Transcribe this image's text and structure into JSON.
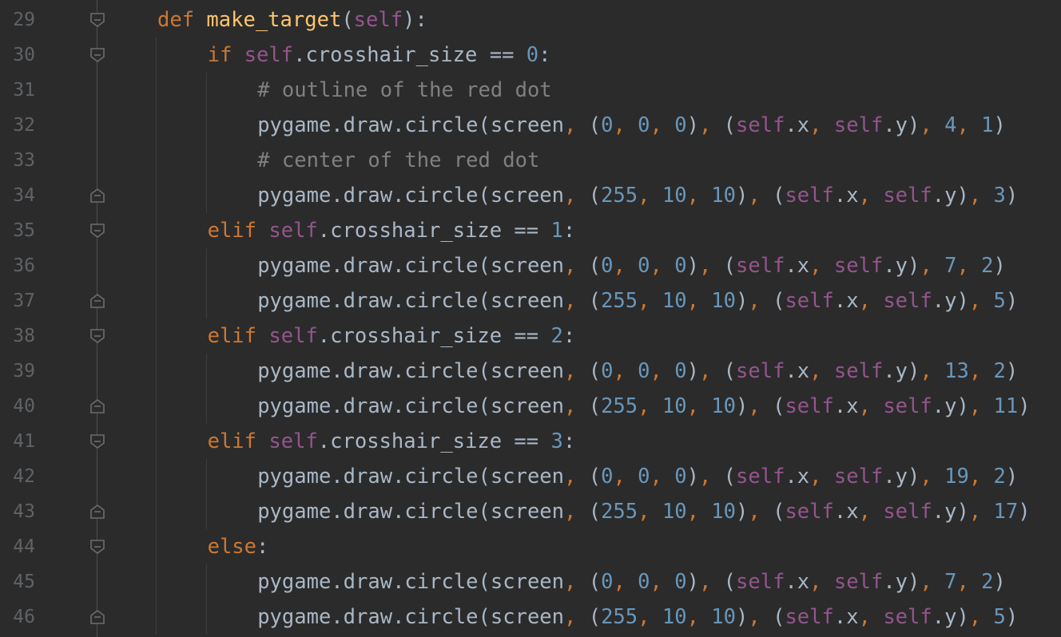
{
  "theme": {
    "background": "#2b2b2b",
    "keyword": "#cc7832",
    "function_name": "#ffc66d",
    "self": "#94558d",
    "number": "#6897bb",
    "comment": "#808080",
    "text": "#a9b7c6",
    "line_number": "#606366"
  },
  "lines": [
    {
      "n": "29",
      "indent": 0,
      "fold": "start",
      "tokens": [
        [
          "kw",
          "def"
        ],
        [
          "tx",
          " "
        ],
        [
          "fn",
          "make_target"
        ],
        [
          "tx",
          "("
        ],
        [
          "slf",
          "self"
        ],
        [
          "tx",
          "):"
        ]
      ]
    },
    {
      "n": "30",
      "indent": 1,
      "fold": "start",
      "tokens": [
        [
          "kw",
          "if"
        ],
        [
          "tx",
          " "
        ],
        [
          "slf",
          "self"
        ],
        [
          "tx",
          ".crosshair_size == "
        ],
        [
          "num",
          "0"
        ],
        [
          "tx",
          ":"
        ]
      ]
    },
    {
      "n": "31",
      "indent": 2,
      "fold": "",
      "tokens": [
        [
          "cm",
          "# outline of the red dot"
        ]
      ]
    },
    {
      "n": "32",
      "indent": 2,
      "fold": "",
      "tokens": [
        [
          "tx",
          "pygame.draw.circle(screen"
        ],
        [
          "pn",
          ", "
        ],
        [
          "tx",
          "("
        ],
        [
          "num",
          "0"
        ],
        [
          "pn",
          ", "
        ],
        [
          "num",
          "0"
        ],
        [
          "pn",
          ", "
        ],
        [
          "num",
          "0"
        ],
        [
          "tx",
          ")"
        ],
        [
          "pn",
          ", "
        ],
        [
          "tx",
          "("
        ],
        [
          "slf",
          "self"
        ],
        [
          "tx",
          ".x"
        ],
        [
          "pn",
          ", "
        ],
        [
          "slf",
          "self"
        ],
        [
          "tx",
          ".y)"
        ],
        [
          "pn",
          ", "
        ],
        [
          "num",
          "4"
        ],
        [
          "pn",
          ", "
        ],
        [
          "num",
          "1"
        ],
        [
          "tx",
          ")"
        ]
      ]
    },
    {
      "n": "33",
      "indent": 2,
      "fold": "",
      "tokens": [
        [
          "cm",
          "# center of the red dot"
        ]
      ]
    },
    {
      "n": "34",
      "indent": 2,
      "fold": "end",
      "tokens": [
        [
          "tx",
          "pygame.draw.circle(screen"
        ],
        [
          "pn",
          ", "
        ],
        [
          "tx",
          "("
        ],
        [
          "num",
          "255"
        ],
        [
          "pn",
          ", "
        ],
        [
          "num",
          "10"
        ],
        [
          "pn",
          ", "
        ],
        [
          "num",
          "10"
        ],
        [
          "tx",
          ")"
        ],
        [
          "pn",
          ", "
        ],
        [
          "tx",
          "("
        ],
        [
          "slf",
          "self"
        ],
        [
          "tx",
          ".x"
        ],
        [
          "pn",
          ", "
        ],
        [
          "slf",
          "self"
        ],
        [
          "tx",
          ".y)"
        ],
        [
          "pn",
          ", "
        ],
        [
          "num",
          "3"
        ],
        [
          "tx",
          ")"
        ]
      ]
    },
    {
      "n": "35",
      "indent": 1,
      "fold": "start",
      "tokens": [
        [
          "kw",
          "elif"
        ],
        [
          "tx",
          " "
        ],
        [
          "slf",
          "self"
        ],
        [
          "tx",
          ".crosshair_size == "
        ],
        [
          "num",
          "1"
        ],
        [
          "tx",
          ":"
        ]
      ]
    },
    {
      "n": "36",
      "indent": 2,
      "fold": "",
      "tokens": [
        [
          "tx",
          "pygame.draw.circle(screen"
        ],
        [
          "pn",
          ", "
        ],
        [
          "tx",
          "("
        ],
        [
          "num",
          "0"
        ],
        [
          "pn",
          ", "
        ],
        [
          "num",
          "0"
        ],
        [
          "pn",
          ", "
        ],
        [
          "num",
          "0"
        ],
        [
          "tx",
          ")"
        ],
        [
          "pn",
          ", "
        ],
        [
          "tx",
          "("
        ],
        [
          "slf",
          "self"
        ],
        [
          "tx",
          ".x"
        ],
        [
          "pn",
          ", "
        ],
        [
          "slf",
          "self"
        ],
        [
          "tx",
          ".y)"
        ],
        [
          "pn",
          ", "
        ],
        [
          "num",
          "7"
        ],
        [
          "pn",
          ", "
        ],
        [
          "num",
          "2"
        ],
        [
          "tx",
          ")"
        ]
      ]
    },
    {
      "n": "37",
      "indent": 2,
      "fold": "end",
      "tokens": [
        [
          "tx",
          "pygame.draw.circle(screen"
        ],
        [
          "pn",
          ", "
        ],
        [
          "tx",
          "("
        ],
        [
          "num",
          "255"
        ],
        [
          "pn",
          ", "
        ],
        [
          "num",
          "10"
        ],
        [
          "pn",
          ", "
        ],
        [
          "num",
          "10"
        ],
        [
          "tx",
          ")"
        ],
        [
          "pn",
          ", "
        ],
        [
          "tx",
          "("
        ],
        [
          "slf",
          "self"
        ],
        [
          "tx",
          ".x"
        ],
        [
          "pn",
          ", "
        ],
        [
          "slf",
          "self"
        ],
        [
          "tx",
          ".y)"
        ],
        [
          "pn",
          ", "
        ],
        [
          "num",
          "5"
        ],
        [
          "tx",
          ")"
        ]
      ]
    },
    {
      "n": "38",
      "indent": 1,
      "fold": "start",
      "tokens": [
        [
          "kw",
          "elif"
        ],
        [
          "tx",
          " "
        ],
        [
          "slf",
          "self"
        ],
        [
          "tx",
          ".crosshair_size == "
        ],
        [
          "num",
          "2"
        ],
        [
          "tx",
          ":"
        ]
      ]
    },
    {
      "n": "39",
      "indent": 2,
      "fold": "",
      "tokens": [
        [
          "tx",
          "pygame.draw.circle(screen"
        ],
        [
          "pn",
          ", "
        ],
        [
          "tx",
          "("
        ],
        [
          "num",
          "0"
        ],
        [
          "pn",
          ", "
        ],
        [
          "num",
          "0"
        ],
        [
          "pn",
          ", "
        ],
        [
          "num",
          "0"
        ],
        [
          "tx",
          ")"
        ],
        [
          "pn",
          ", "
        ],
        [
          "tx",
          "("
        ],
        [
          "slf",
          "self"
        ],
        [
          "tx",
          ".x"
        ],
        [
          "pn",
          ", "
        ],
        [
          "slf",
          "self"
        ],
        [
          "tx",
          ".y)"
        ],
        [
          "pn",
          ", "
        ],
        [
          "num",
          "13"
        ],
        [
          "pn",
          ", "
        ],
        [
          "num",
          "2"
        ],
        [
          "tx",
          ")"
        ]
      ]
    },
    {
      "n": "40",
      "indent": 2,
      "fold": "end",
      "tokens": [
        [
          "tx",
          "pygame.draw.circle(screen"
        ],
        [
          "pn",
          ", "
        ],
        [
          "tx",
          "("
        ],
        [
          "num",
          "255"
        ],
        [
          "pn",
          ", "
        ],
        [
          "num",
          "10"
        ],
        [
          "pn",
          ", "
        ],
        [
          "num",
          "10"
        ],
        [
          "tx",
          ")"
        ],
        [
          "pn",
          ", "
        ],
        [
          "tx",
          "("
        ],
        [
          "slf",
          "self"
        ],
        [
          "tx",
          ".x"
        ],
        [
          "pn",
          ", "
        ],
        [
          "slf",
          "self"
        ],
        [
          "tx",
          ".y)"
        ],
        [
          "pn",
          ", "
        ],
        [
          "num",
          "11"
        ],
        [
          "tx",
          ")"
        ]
      ]
    },
    {
      "n": "41",
      "indent": 1,
      "fold": "start",
      "tokens": [
        [
          "kw",
          "elif"
        ],
        [
          "tx",
          " "
        ],
        [
          "slf",
          "self"
        ],
        [
          "tx",
          ".crosshair_size == "
        ],
        [
          "num",
          "3"
        ],
        [
          "tx",
          ":"
        ]
      ]
    },
    {
      "n": "42",
      "indent": 2,
      "fold": "",
      "tokens": [
        [
          "tx",
          "pygame.draw.circle(screen"
        ],
        [
          "pn",
          ", "
        ],
        [
          "tx",
          "("
        ],
        [
          "num",
          "0"
        ],
        [
          "pn",
          ", "
        ],
        [
          "num",
          "0"
        ],
        [
          "pn",
          ", "
        ],
        [
          "num",
          "0"
        ],
        [
          "tx",
          ")"
        ],
        [
          "pn",
          ", "
        ],
        [
          "tx",
          "("
        ],
        [
          "slf",
          "self"
        ],
        [
          "tx",
          ".x"
        ],
        [
          "pn",
          ", "
        ],
        [
          "slf",
          "self"
        ],
        [
          "tx",
          ".y)"
        ],
        [
          "pn",
          ", "
        ],
        [
          "num",
          "19"
        ],
        [
          "pn",
          ", "
        ],
        [
          "num",
          "2"
        ],
        [
          "tx",
          ")"
        ]
      ]
    },
    {
      "n": "43",
      "indent": 2,
      "fold": "end",
      "tokens": [
        [
          "tx",
          "pygame.draw.circle(screen"
        ],
        [
          "pn",
          ", "
        ],
        [
          "tx",
          "("
        ],
        [
          "num",
          "255"
        ],
        [
          "pn",
          ", "
        ],
        [
          "num",
          "10"
        ],
        [
          "pn",
          ", "
        ],
        [
          "num",
          "10"
        ],
        [
          "tx",
          ")"
        ],
        [
          "pn",
          ", "
        ],
        [
          "tx",
          "("
        ],
        [
          "slf",
          "self"
        ],
        [
          "tx",
          ".x"
        ],
        [
          "pn",
          ", "
        ],
        [
          "slf",
          "self"
        ],
        [
          "tx",
          ".y)"
        ],
        [
          "pn",
          ", "
        ],
        [
          "num",
          "17"
        ],
        [
          "tx",
          ")"
        ]
      ]
    },
    {
      "n": "44",
      "indent": 1,
      "fold": "start",
      "tokens": [
        [
          "kw",
          "else"
        ],
        [
          "tx",
          ":"
        ]
      ]
    },
    {
      "n": "45",
      "indent": 2,
      "fold": "",
      "tokens": [
        [
          "tx",
          "pygame.draw.circle(screen"
        ],
        [
          "pn",
          ", "
        ],
        [
          "tx",
          "("
        ],
        [
          "num",
          "0"
        ],
        [
          "pn",
          ", "
        ],
        [
          "num",
          "0"
        ],
        [
          "pn",
          ", "
        ],
        [
          "num",
          "0"
        ],
        [
          "tx",
          ")"
        ],
        [
          "pn",
          ", "
        ],
        [
          "tx",
          "("
        ],
        [
          "slf",
          "self"
        ],
        [
          "tx",
          ".x"
        ],
        [
          "pn",
          ", "
        ],
        [
          "slf",
          "self"
        ],
        [
          "tx",
          ".y)"
        ],
        [
          "pn",
          ", "
        ],
        [
          "num",
          "7"
        ],
        [
          "pn",
          ", "
        ],
        [
          "num",
          "2"
        ],
        [
          "tx",
          ")"
        ]
      ]
    },
    {
      "n": "46",
      "indent": 2,
      "fold": "end",
      "tokens": [
        [
          "tx",
          "pygame.draw.circle(screen"
        ],
        [
          "pn",
          ", "
        ],
        [
          "tx",
          "("
        ],
        [
          "num",
          "255"
        ],
        [
          "pn",
          ", "
        ],
        [
          "num",
          "10"
        ],
        [
          "pn",
          ", "
        ],
        [
          "num",
          "10"
        ],
        [
          "tx",
          ")"
        ],
        [
          "pn",
          ", "
        ],
        [
          "tx",
          "("
        ],
        [
          "slf",
          "self"
        ],
        [
          "tx",
          ".x"
        ],
        [
          "pn",
          ", "
        ],
        [
          "slf",
          "self"
        ],
        [
          "tx",
          ".y)"
        ],
        [
          "pn",
          ", "
        ],
        [
          "num",
          "5"
        ],
        [
          "tx",
          ")"
        ]
      ]
    }
  ]
}
